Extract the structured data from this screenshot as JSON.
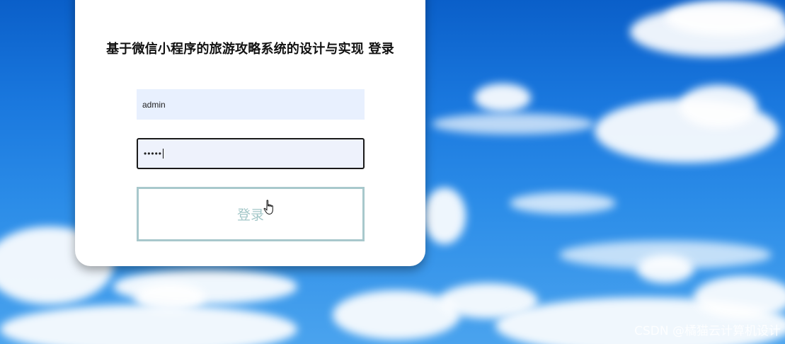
{
  "login": {
    "title": "基于微信小程序的旅游攻略系统的设计与实现 登录",
    "username_value": "admin",
    "password_value": "•••••",
    "button_label": "登录"
  },
  "watermark": "CSDN @橘猫云计算机设计",
  "colors": {
    "sky_top": "#0a5fc9",
    "sky_bottom": "#4aa3ee",
    "username_bg": "#e8f0fe",
    "password_bg": "#eef2fc",
    "button_border": "#a8c8cc",
    "button_text": "#a3c7c8"
  },
  "icons": {
    "cursor": "hand-pointer-icon"
  }
}
